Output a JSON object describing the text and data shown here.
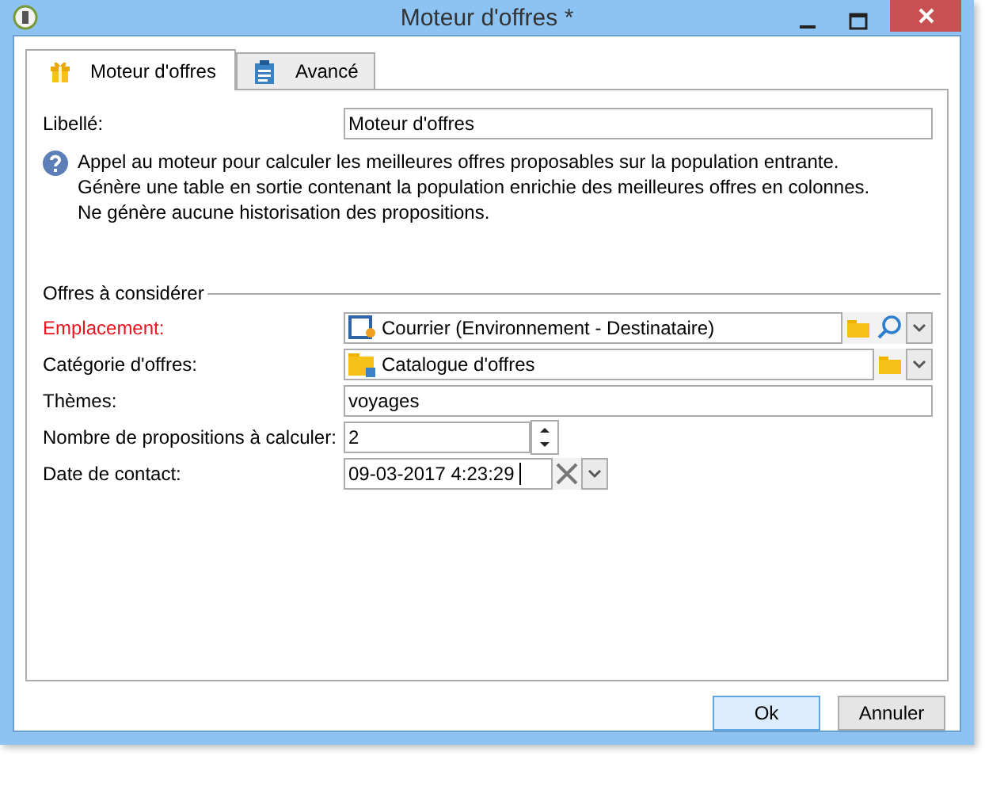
{
  "window": {
    "title": "Moteur d'offres *"
  },
  "tabs": [
    {
      "label": "Moteur d'offres",
      "selected": true
    },
    {
      "label": "Avancé",
      "selected": false
    }
  ],
  "label_field": {
    "label": "Libellé:",
    "value": "Moteur d'offres"
  },
  "description": [
    "Appel au moteur pour calculer les meilleures offres proposables sur la population entrante.",
    "Génère une table en sortie contenant la population enrichie des meilleures offres en colonnes.",
    "Ne génère aucune historisation des propositions."
  ],
  "section": {
    "title": "Offres à considérer"
  },
  "fields": [
    {
      "kind": "link",
      "label": "Emplacement:",
      "value": "Courrier (Environnement - Destinataire)",
      "required": true
    },
    {
      "kind": "folder",
      "label": "Catégorie d'offres:",
      "value": "Catalogue d'offres",
      "required": false
    },
    {
      "kind": "text",
      "label": "Thèmes:",
      "value": "voyages",
      "required": false
    },
    {
      "kind": "spin",
      "label": "Nombre de propositions à calculer:",
      "value": "2",
      "required": false
    },
    {
      "kind": "date",
      "label": "Date de contact:",
      "value": "09-03-2017 4:23:29",
      "required": false
    }
  ],
  "buttons": [
    {
      "label": "Ok",
      "default": true
    },
    {
      "label": "Annuler",
      "default": false
    }
  ]
}
